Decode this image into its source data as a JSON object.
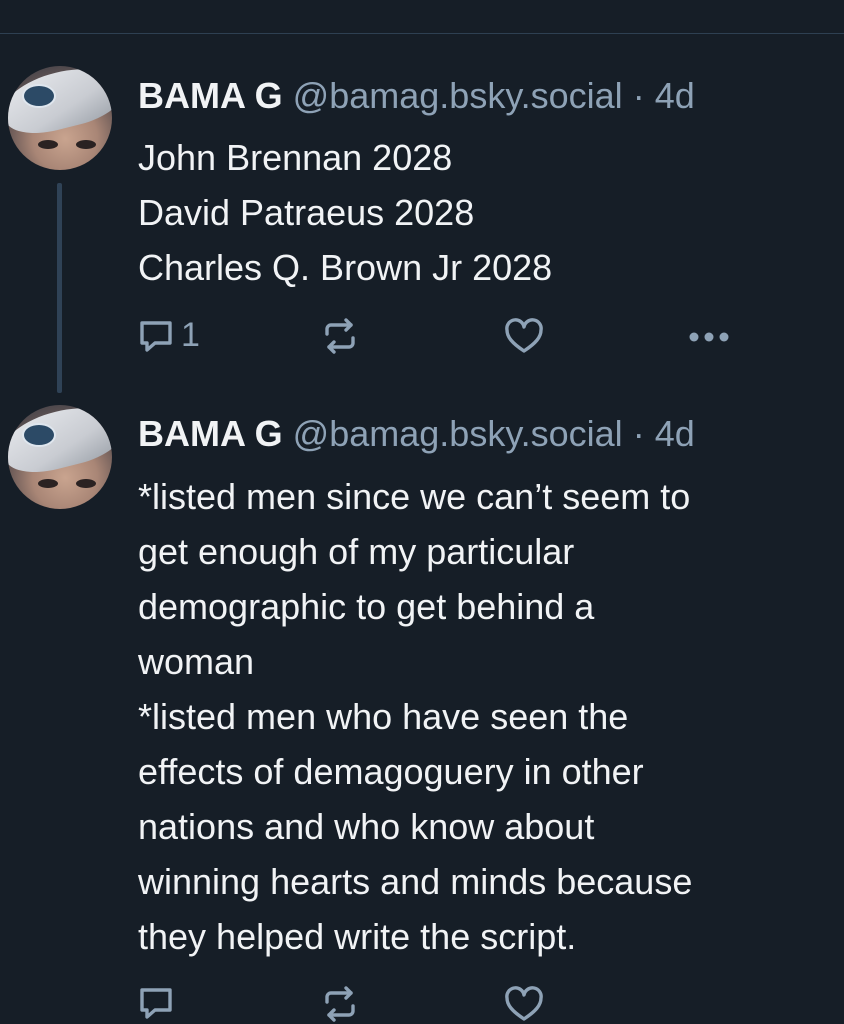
{
  "posts": [
    {
      "author_name": "BAMA G",
      "handle": "@bamag.bsky.social",
      "separator": "·",
      "time": "4d",
      "lines": [
        "John Brennan 2028",
        "David Patraeus 2028",
        "Charles Q. Brown Jr 2028"
      ],
      "reply_count": "1"
    },
    {
      "author_name": "BAMA G",
      "handle": "@bamag.bsky.social",
      "separator": "·",
      "time": "4d",
      "lines": [
        "*listed men since we can’t seem to",
        "get enough of my particular",
        "demographic to get behind a",
        "woman",
        "*listed men who have seen the",
        "effects of demagoguery in other",
        "nations and who know about",
        "winning hearts and minds because",
        "they helped write the script."
      ]
    }
  ],
  "icons": {
    "reply": "speech-bubble-icon",
    "repost": "repost-arrows-icon",
    "like": "heart-icon",
    "more": "ellipsis-icon"
  },
  "colors": {
    "background": "#161e27",
    "text": "#f1f3f5",
    "muted": "#8ea2b6",
    "thread_line": "#2f4256"
  }
}
